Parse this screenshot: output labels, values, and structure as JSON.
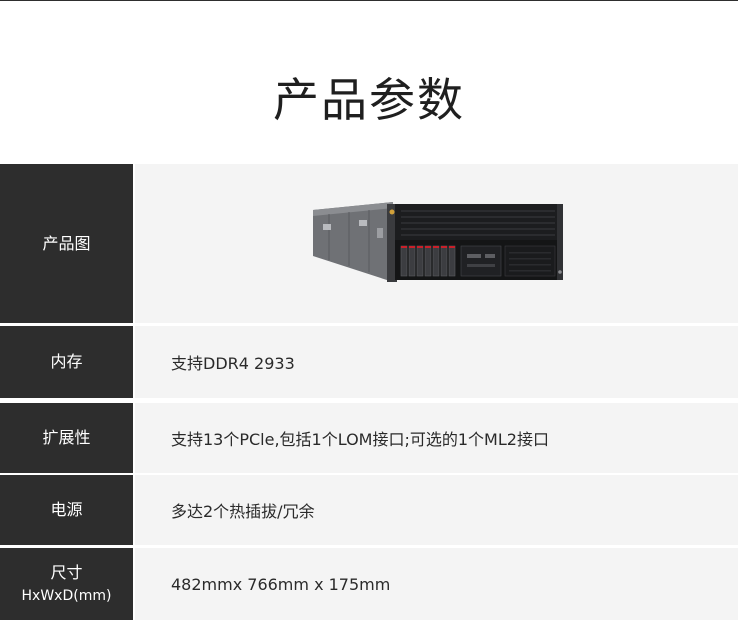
{
  "page_title": "产品参数",
  "rows": [
    {
      "label": "产品图",
      "value": "",
      "image": "server-product-image"
    },
    {
      "label": "内存",
      "value": "支持DDR4 2933"
    },
    {
      "label": "扩展性",
      "value": "支持13个PCle,包括1个LOM接口;可选的1个ML2接口"
    },
    {
      "label": "电源",
      "value": "多达2个热插拔/冗余"
    },
    {
      "label": "尺寸",
      "sublabel": "HxWxD(mm)",
      "value": "482mmx 766mm x 175mm"
    }
  ],
  "colors": {
    "label_bg": "#2d2d2d",
    "value_bg": "#f4f4f4",
    "title_text": "#1f1f1f"
  }
}
